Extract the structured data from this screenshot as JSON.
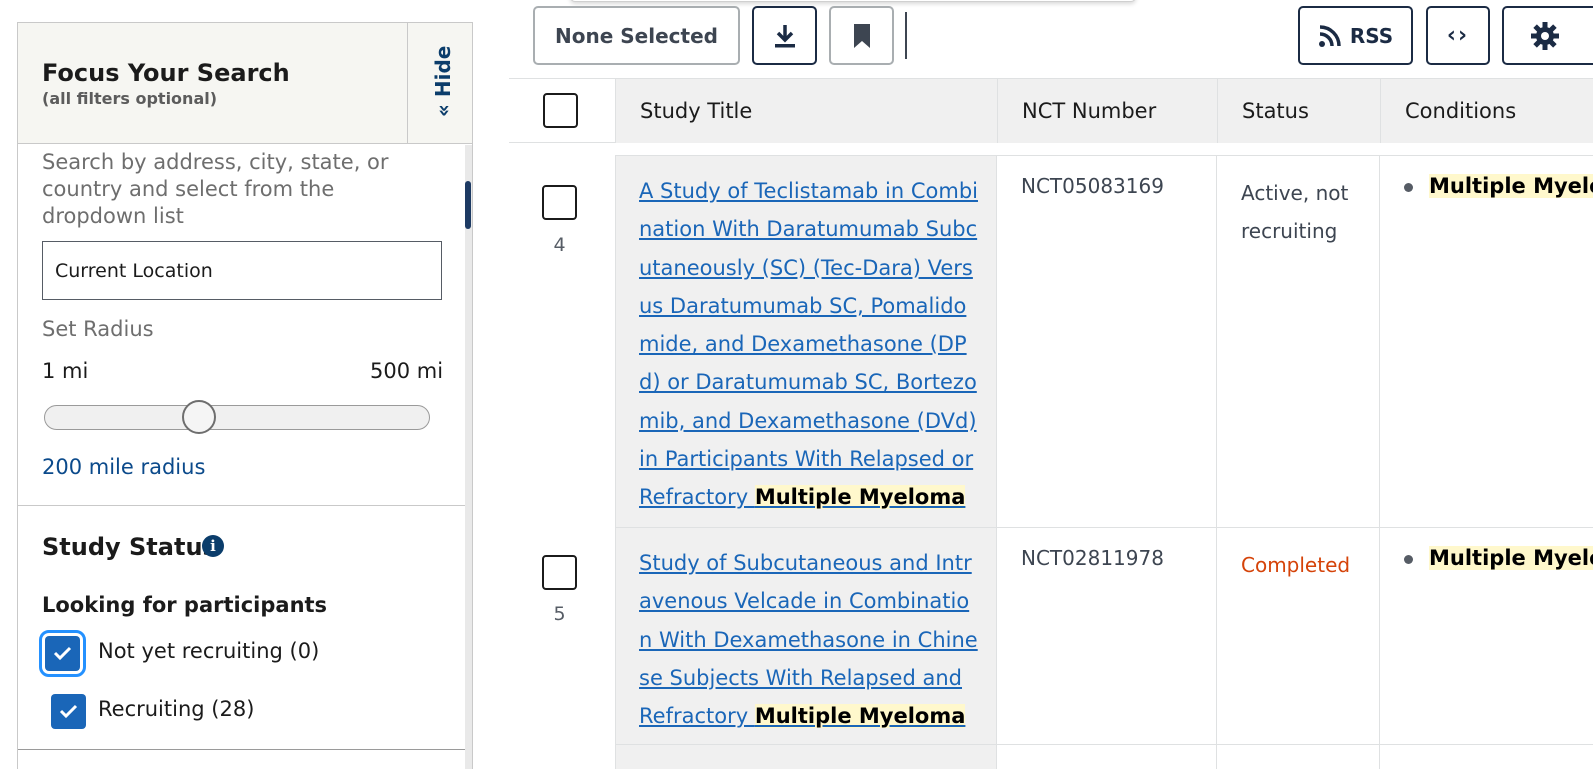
{
  "sidebar": {
    "title": "Focus Your Search",
    "subtitle": "(all filters optional)",
    "hide_label": "Hide",
    "hide_chevron": "«",
    "location_help": "Search by address, city, state, or country and select from the dropdown list",
    "location_value": "Current Location",
    "radius_label": "Set Radius",
    "radius_min": "1 mi",
    "radius_max": "500 mi",
    "radius_value": "200 mile radius",
    "radius_slider_fraction": 0.4,
    "status_heading": "Study Status",
    "info_glyph": "i",
    "looking_heading": "Looking for participants",
    "status_options": [
      {
        "label": "Not yet recruiting (0)",
        "checked": true
      },
      {
        "label": "Recruiting (28)",
        "checked": true
      }
    ]
  },
  "toolbar": {
    "none_selected": "None Selected",
    "download_icon": "download-icon",
    "bookmark_icon": "bookmark-icon",
    "rss_label": "RSS",
    "code_label": "‹›",
    "settings_icon": "gear-icon"
  },
  "table": {
    "columns": [
      "Study Title",
      "NCT Number",
      "Status",
      "Conditions"
    ],
    "rows": [
      {
        "number": "4",
        "title_prefix": "A Study of Teclistamab in Combination With Daratumumab Subcutaneously (SC) (Tec-Dara) Versus Daratumumab SC, Pomalidomide, and Dexamethasone (DPd) or Daratumumab SC, Bortezomib, and Dexamethasone (DVd) in Participants With Relapsed or Refractory ",
        "title_highlight": "Multiple Myeloma",
        "nct": "NCT05083169",
        "status": "Active, not recruiting",
        "condition": "Multiple Myeloma"
      },
      {
        "number": "5",
        "title_prefix": "Study of Subcutaneous and Intravenous Velcade in Combination With Dexamethasone in Chinese Subjects With Relapsed and Refractory ",
        "title_highlight": "Multiple Myeloma",
        "nct": "NCT02811978",
        "status": "Completed",
        "condition": "Multiple Myeloma"
      }
    ]
  },
  "colors": {
    "link": "#1a66b8",
    "completed_status": "#d54309",
    "highlight": "#fff8cc",
    "checkbox": "#1a66b8",
    "dark_navy": "#1b2b44"
  }
}
